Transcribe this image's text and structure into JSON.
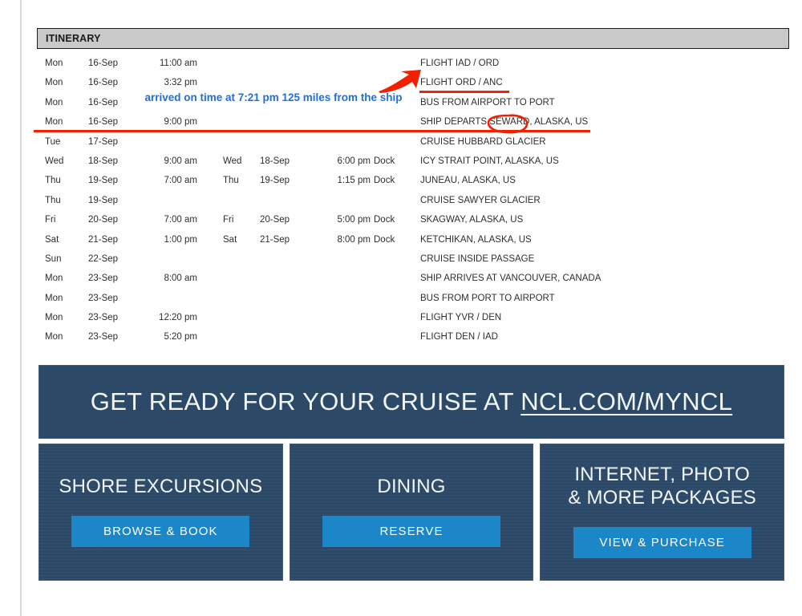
{
  "document": {
    "section_title": "ITINERARY"
  },
  "itinerary": {
    "rows": [
      {
        "day1": "Mon",
        "date1": "16-Sep",
        "time1": "11:00 am",
        "day2": "",
        "date2": "",
        "time2": "",
        "dock": "",
        "desc": "FLIGHT IAD / ORD"
      },
      {
        "day1": "Mon",
        "date1": "16-Sep",
        "time1": "3:32 pm",
        "day2": "",
        "date2": "",
        "time2": "",
        "dock": "",
        "desc": "FLIGHT ORD / ANC"
      },
      {
        "day1": "Mon",
        "date1": "16-Sep",
        "time1": "",
        "day2": "",
        "date2": "",
        "time2": "",
        "dock": "",
        "desc": "BUS FROM AIRPORT TO PORT"
      },
      {
        "day1": "Mon",
        "date1": "16-Sep",
        "time1": "9:00 pm",
        "day2": "",
        "date2": "",
        "time2": "",
        "dock": "",
        "desc": "SHIP DEPARTS SEWARD, ALASKA, US"
      },
      {
        "day1": "Tue",
        "date1": "17-Sep",
        "time1": "",
        "day2": "",
        "date2": "",
        "time2": "",
        "dock": "",
        "desc": "CRUISE HUBBARD GLACIER"
      },
      {
        "day1": "Wed",
        "date1": "18-Sep",
        "time1": "9:00 am",
        "day2": "Wed",
        "date2": "18-Sep",
        "time2": "6:00 pm",
        "dock": "Dock",
        "desc": "ICY STRAIT POINT, ALASKA, US"
      },
      {
        "day1": "Thu",
        "date1": "19-Sep",
        "time1": "7:00 am",
        "day2": "Thu",
        "date2": "19-Sep",
        "time2": "1:15 pm",
        "dock": "Dock",
        "desc": "JUNEAU, ALASKA, US"
      },
      {
        "day1": "Thu",
        "date1": "19-Sep",
        "time1": "",
        "day2": "",
        "date2": "",
        "time2": "",
        "dock": "",
        "desc": "CRUISE SAWYER GLACIER"
      },
      {
        "day1": "Fri",
        "date1": "20-Sep",
        "time1": "7:00 am",
        "day2": "Fri",
        "date2": "20-Sep",
        "time2": "5:00 pm",
        "dock": "Dock",
        "desc": "SKAGWAY, ALASKA, US"
      },
      {
        "day1": "Sat",
        "date1": "21-Sep",
        "time1": "1:00 pm",
        "day2": "Sat",
        "date2": "21-Sep",
        "time2": "8:00 pm",
        "dock": "Dock",
        "desc": "KETCHIKAN, ALASKA, US"
      },
      {
        "day1": "Sun",
        "date1": "22-Sep",
        "time1": "",
        "day2": "",
        "date2": "",
        "time2": "",
        "dock": "",
        "desc": "CRUISE INSIDE PASSAGE"
      },
      {
        "day1": "Mon",
        "date1": "23-Sep",
        "time1": "8:00 am",
        "day2": "",
        "date2": "",
        "time2": "",
        "dock": "",
        "desc": "SHIP ARRIVES AT VANCOUVER, CANADA"
      },
      {
        "day1": "Mon",
        "date1": "23-Sep",
        "time1": "",
        "day2": "",
        "date2": "",
        "time2": "",
        "dock": "",
        "desc": "BUS FROM PORT TO AIRPORT"
      },
      {
        "day1": "Mon",
        "date1": "23-Sep",
        "time1": "12:20 pm",
        "day2": "",
        "date2": "",
        "time2": "",
        "dock": "",
        "desc": "FLIGHT YVR / DEN"
      },
      {
        "day1": "Mon",
        "date1": "23-Sep",
        "time1": "5:20 pm",
        "day2": "",
        "date2": "",
        "time2": "",
        "dock": "",
        "desc": "FLIGHT DEN / IAD"
      }
    ]
  },
  "annotations": {
    "note_text": "arrived on time at 7:21 pm 125 miles from the ship",
    "note_color": "#1f6fe0",
    "mark_color": "#f02000",
    "arrow_target": "FLIGHT ORD / ANC",
    "circled_term": "SEWARD"
  },
  "promo": {
    "banner": {
      "lead": "GET READY FOR YOUR CRUISE AT ",
      "link": "NCL.COM/MYNCL"
    },
    "cards": [
      {
        "title": "SHORE EXCURSIONS",
        "button": "BROWSE & BOOK"
      },
      {
        "title": "DINING",
        "button": "RESERVE"
      },
      {
        "title": "INTERNET, PHOTO\n& MORE PACKAGES",
        "button": "VIEW & PURCHASE"
      }
    ],
    "colors": {
      "panel": "#2c4a68",
      "button": "#1b86c8",
      "text": "#f2f5f8"
    }
  }
}
